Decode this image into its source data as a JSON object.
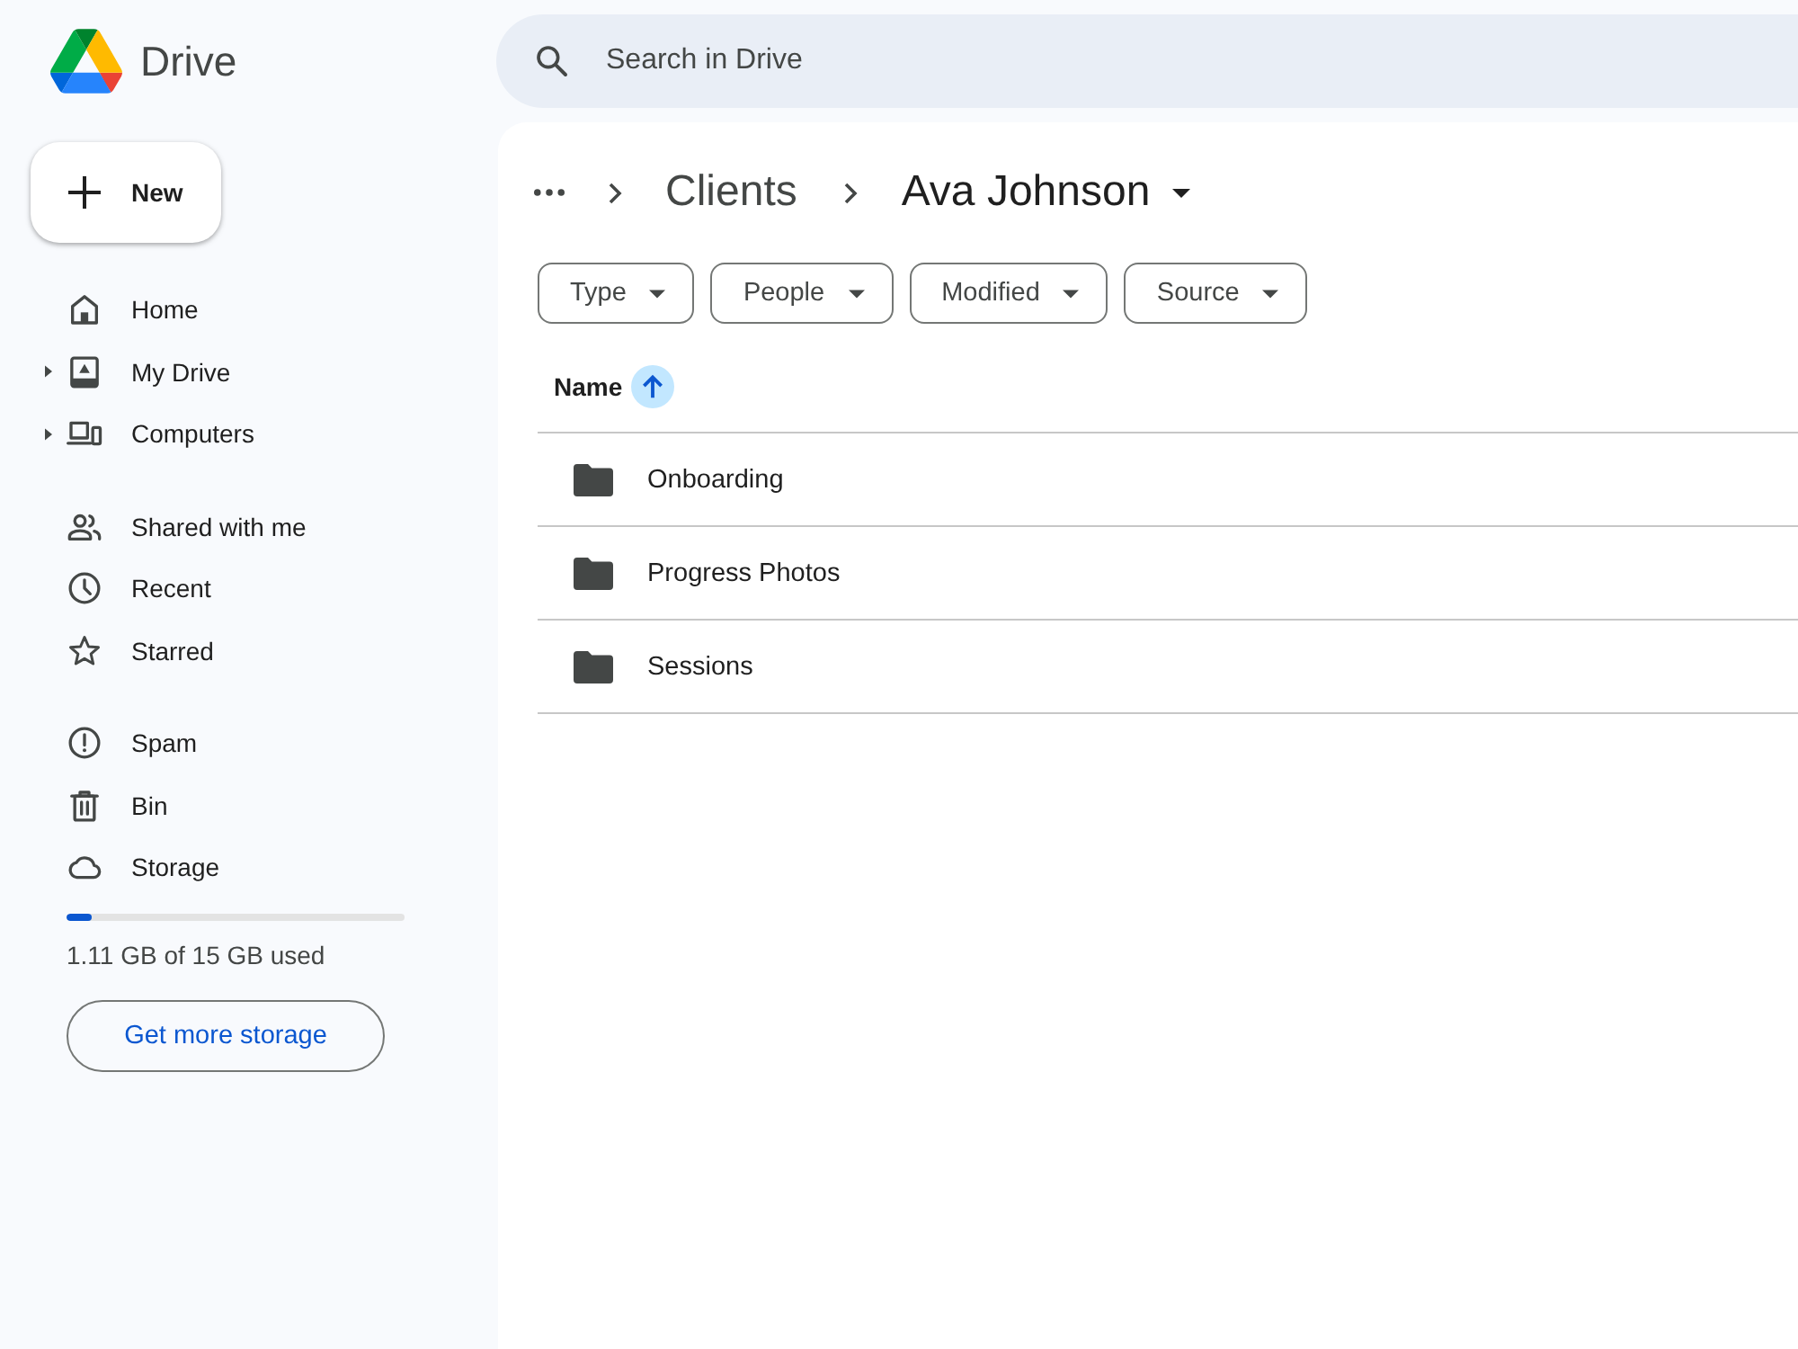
{
  "header": {
    "app_name": "Drive",
    "search": {
      "placeholder": "Search in Drive"
    }
  },
  "sidebar": {
    "new_button": {
      "label": "New"
    },
    "groups": [
      {
        "items": [
          {
            "label": "Home",
            "expandable": false,
            "selected": false
          },
          {
            "label": "My Drive",
            "expandable": true,
            "selected": false
          },
          {
            "label": "Computers",
            "expandable": true,
            "selected": false
          }
        ]
      },
      {
        "items": [
          {
            "label": "Shared with me",
            "expandable": false,
            "selected": false
          },
          {
            "label": "Recent",
            "expandable": false,
            "selected": false
          },
          {
            "label": "Starred",
            "expandable": false,
            "selected": false
          }
        ]
      },
      {
        "items": [
          {
            "label": "Spam",
            "expandable": false,
            "selected": false
          },
          {
            "label": "Bin",
            "expandable": false,
            "selected": false
          },
          {
            "label": "Storage",
            "expandable": false,
            "selected": false
          }
        ]
      }
    ],
    "storage": {
      "level": 0.074,
      "usage": "1.11 GB of 15 GB used",
      "button": "Get more storage"
    }
  },
  "breadcrumb": {
    "items": [
      {
        "label": "Clients",
        "current": false
      },
      {
        "label": "Ava Johnson",
        "current": true
      }
    ]
  },
  "filters": [
    {
      "label": "Type"
    },
    {
      "label": "People"
    },
    {
      "label": "Modified"
    },
    {
      "label": "Source"
    }
  ],
  "table": {
    "columns": [
      {
        "label": "Name",
        "sorted": true,
        "ascending": true
      }
    ],
    "rows": [
      {
        "name": "Onboarding",
        "selected": false
      },
      {
        "name": "Progress Photos",
        "selected": false
      },
      {
        "name": "Sessions",
        "selected": false
      }
    ]
  }
}
